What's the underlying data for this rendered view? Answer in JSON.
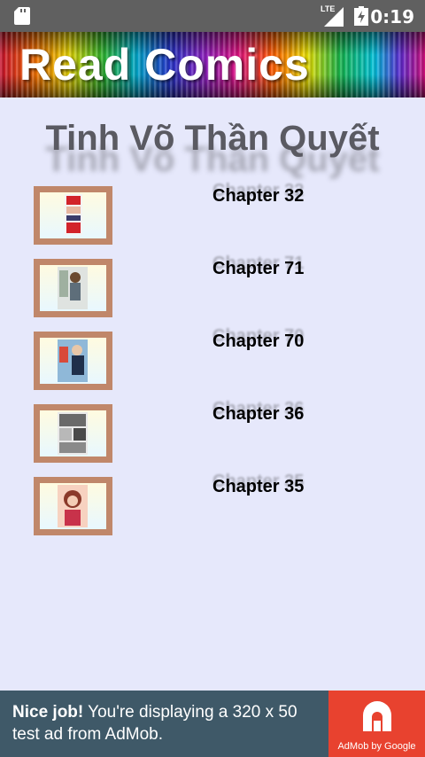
{
  "status_bar": {
    "network": "LTE",
    "time": "0:19",
    "icons": [
      "sd-card-icon",
      "signal-icon",
      "battery-icon"
    ]
  },
  "header": {
    "banner_title": "Read Comics"
  },
  "comic": {
    "title": "Tinh Võ Thần Quyết"
  },
  "chapters": [
    {
      "label": "Chapter 32",
      "thumbnail": "comic-thumbnail"
    },
    {
      "label": "Chapter 71",
      "thumbnail": "comic-thumbnail"
    },
    {
      "label": "Chapter 70",
      "thumbnail": "comic-thumbnail"
    },
    {
      "label": "Chapter 36",
      "thumbnail": "comic-thumbnail"
    },
    {
      "label": "Chapter 35",
      "thumbnail": "comic-thumbnail"
    }
  ],
  "ad": {
    "headline": "Nice job!",
    "body": " You're displaying a 320 x 50 test ad from AdMob.",
    "logo_text": "AdMob by Google"
  },
  "colors": {
    "background": "#e6e8fb",
    "status_bar": "#606060",
    "thumb_frame": "#c0876a",
    "ad_background": "#3f5968",
    "ad_logo": "#e8422f"
  }
}
